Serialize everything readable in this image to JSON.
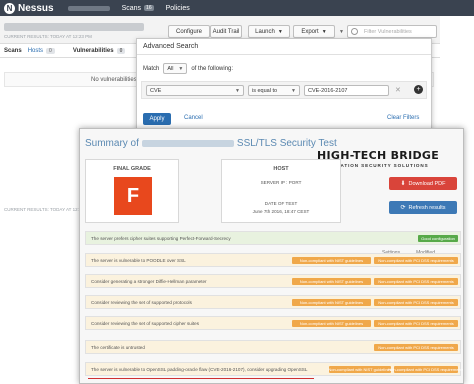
{
  "app": {
    "logo": "Nessus",
    "logo_letter": "N"
  },
  "nav": {
    "scans": "Scans",
    "scans_badge": "16",
    "policies": "Policies"
  },
  "toolbar": {
    "configure": "Configure",
    "audit_trail": "Audit Trail",
    "launch": "Launch",
    "export": "Export",
    "filter_placeholder": "Filter Vulnerabilities"
  },
  "scan": {
    "subtitle": "CURRENT RESULTS: TODAY AT 12:23 PM"
  },
  "tabs": {
    "scans": "Scans",
    "hosts": "Hosts",
    "hosts_count": "0",
    "vulnerabilities": "Vulnerabilities",
    "vuln_count": "0"
  },
  "results": {
    "empty": "No vulnerabilities"
  },
  "adv": {
    "title": "Advanced Search",
    "match_label": "Match",
    "match_value": "All",
    "match_suffix": "of the following:",
    "field": "CVE",
    "operator": "is equal to",
    "value": "CVE-2016-2107",
    "apply": "Apply",
    "cancel": "Cancel",
    "clear": "Clear Filters"
  },
  "report": {
    "title_prefix": "Summary of",
    "title_suffix": "SSL/TLS Security Test",
    "logo_main_a": "HIGH-TECH BRIDGE",
    "logo_sub": "INFORMATION SECURITY SOLUTIONS",
    "final_grade_label": "FINAL GRADE",
    "grade": "F",
    "host_label": "HOST",
    "server_ip": "SERVER IP : PORT",
    "date_label": "DATE OF TEST",
    "date_value": "June 7th 2016, 18:47 CEST",
    "download_pdf": "Download PDF",
    "refresh": "Refresh results",
    "peek_a": "Settings",
    "peek_b": "Modified"
  },
  "findings": [
    {
      "text": "The server prefers cipher suites supporting Perfect-Forward-Secrecy",
      "status": "good",
      "badges": [
        "Good configuration"
      ]
    },
    {
      "text": "The server is vulnerable to POODLE over SSL",
      "status": "warn",
      "badges": [
        "Non-compliant with NIST guidelines",
        "Non-compliant with PCI DSS requirements"
      ]
    },
    {
      "text": "Consider generating a stronger Diffie-Hellman parameter",
      "status": "warn",
      "badges": [
        "Non-compliant with NIST guidelines",
        "Non-compliant with PCI DSS requirements"
      ]
    },
    {
      "text": "Consider reviewing the set of supported protocols",
      "status": "warn",
      "badges": [
        "Non-compliant with NIST guidelines",
        "Non-compliant with PCI DSS requirements"
      ]
    },
    {
      "text": "Consider reviewing the set of supported cipher suites",
      "status": "warn",
      "badges": [
        "Non-compliant with NIST guidelines",
        "Non-compliant with PCI DSS requirements"
      ]
    },
    {
      "text": "The certificate is untrusted",
      "status": "warn",
      "badges": [
        "Non-compliant with PCI DSS requirements"
      ]
    },
    {
      "text": "The server is vulnerable to OpenSSL padding-oracle flaw (CVE-2016-2107), consider upgrading OpenSSL",
      "status": "warn",
      "badges": [
        "Non-compliant with NIST guidelines",
        "Non-compliant with PCI DSS requirements"
      ]
    }
  ],
  "colors": {
    "accent": "#2a6db0",
    "grade_f": "#e8481d",
    "good": "#57a949",
    "warn": "#f0a84a"
  }
}
